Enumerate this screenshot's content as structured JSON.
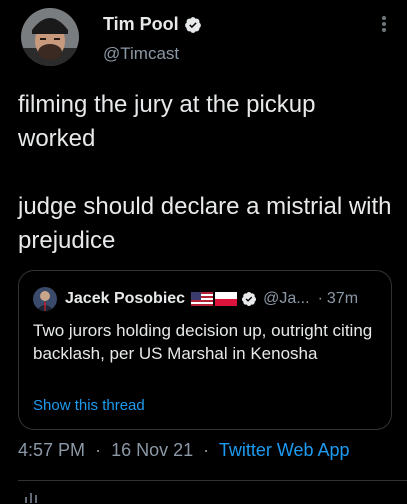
{
  "author": {
    "name": "Tim Pool",
    "handle": "@Timcast",
    "avatar_icon": "profile-photo",
    "verified_icon": "verified-badge-icon"
  },
  "more_icon": "more-vertical-icon",
  "tweet": {
    "paragraphs": [
      "filming the jury at the pickup worked",
      "judge should declare a mistrial with prejudice"
    ]
  },
  "quoted_tweet": {
    "name": "Jacek Posobiec",
    "flags": [
      "us-flag-icon",
      "poland-flag-icon"
    ],
    "handle": "@Ja...",
    "separator": "·",
    "time": "37m",
    "text": "Two jurors holding decision up, outright citing backlash, per US Marshal in Kenosha",
    "show_thread": "Show this thread"
  },
  "meta": {
    "time": "4:57 PM",
    "separator": "·",
    "date": "16 Nov 21",
    "app": "Twitter Web App"
  },
  "colors": {
    "background": "#000000",
    "text": "#e7e9ea",
    "muted": "#8b98a5",
    "link": "#1d9bf0",
    "border": "#2f3336"
  }
}
